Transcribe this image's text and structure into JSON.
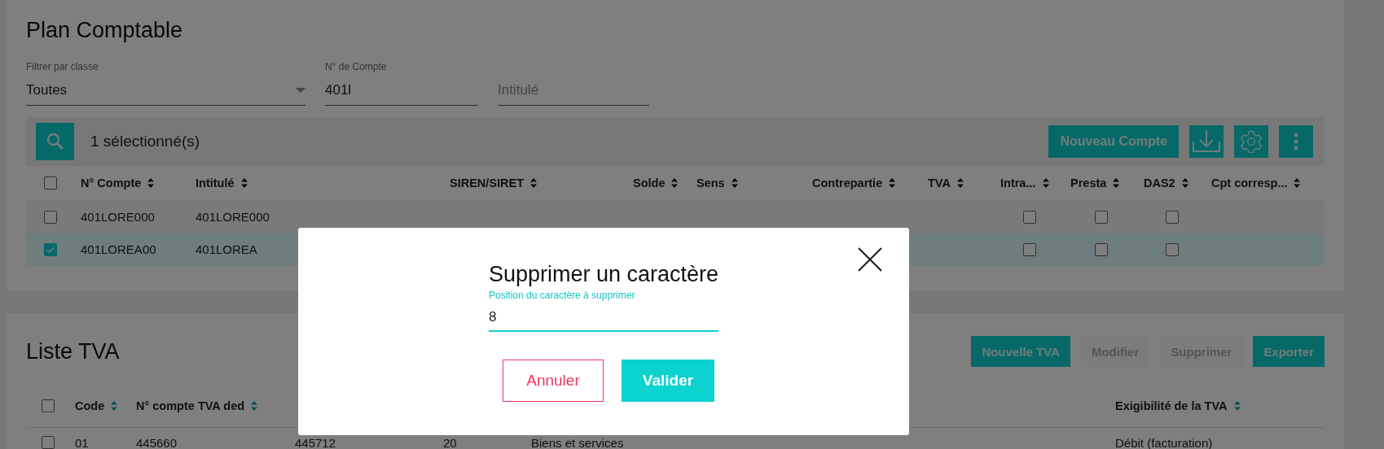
{
  "plan_comptable": {
    "title": "Plan Comptable",
    "filters": [
      {
        "kind": "select",
        "label": "Filtrer par classe",
        "value": "Toutes"
      },
      {
        "kind": "text",
        "label": "N° de Compte",
        "value": "401l"
      },
      {
        "kind": "text",
        "placeholder": "Intitulé"
      }
    ],
    "toolbar": {
      "selection_count": "1 sélectionné(s)",
      "buttons": [
        {
          "kind": "text",
          "label": "Nouveau Compte"
        },
        {
          "kind": "download"
        },
        {
          "kind": "settings"
        },
        {
          "kind": "more"
        }
      ]
    },
    "table": {
      "header_checked": false,
      "columns": [
        "N° Compte",
        "Intitulé",
        "SIREN/SIRET",
        "Solde",
        "Sens",
        "Contrepartie",
        "TVA",
        "Intra...",
        "Presta",
        "DAS2",
        "Cpt corresp..."
      ],
      "rows": [
        {
          "selected": false,
          "n_compte": "401LORE000",
          "intitule": "401LORE000",
          "intra": false,
          "presta": false,
          "das2": false
        },
        {
          "selected": true,
          "n_compte": "401LOREA00",
          "intitule": "401LOREA",
          "intra": false,
          "presta": false,
          "das2": false
        }
      ]
    }
  },
  "liste_tva": {
    "title": "Liste TVA",
    "buttons": [
      {
        "label": "Nouvelle TVA",
        "disabled": false
      },
      {
        "label": "Modifier",
        "disabled": true
      },
      {
        "label": "Supprimer",
        "disabled": true
      },
      {
        "label": "Exporter",
        "disabled": false
      }
    ],
    "table": {
      "header_checked": false,
      "columns": [
        "Code",
        "N° compte TVA ded",
        "",
        "",
        "",
        "Exigibilité de la TVA"
      ],
      "rows": [
        {
          "checked": false,
          "cells": [
            "01",
            "445660",
            "445712",
            "20",
            "Biens et services",
            "Débit (facturation)"
          ]
        }
      ]
    }
  },
  "dialog": {
    "title": "Supprimer un caractère",
    "field": {
      "label": "Position du caractère à supprimer",
      "value": "8"
    },
    "buttons": [
      {
        "kind": "cancel",
        "label": "Annuler"
      },
      {
        "kind": "confirm",
        "label": "Valider"
      }
    ]
  }
}
